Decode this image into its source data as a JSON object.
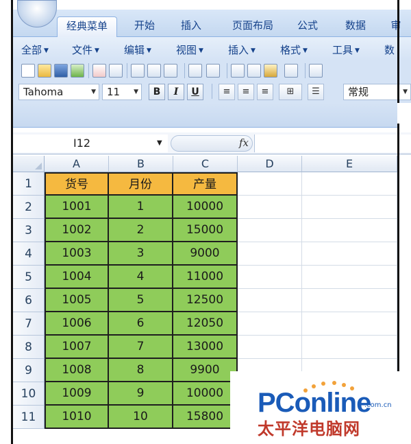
{
  "ribbon": {
    "tabs": [
      "经典菜单",
      "开始",
      "插入",
      "页面布局",
      "公式",
      "数据",
      "审"
    ],
    "active_tab": "经典菜单"
  },
  "menu": {
    "items": [
      "全部",
      "文件",
      "编辑",
      "视图",
      "插入",
      "格式",
      "工具",
      "数"
    ]
  },
  "format_toolbar": {
    "font_name": "Tahoma",
    "font_size": "11",
    "bold": "B",
    "italic": "I",
    "underline": "U",
    "number_format": "常规"
  },
  "formula_bar": {
    "name_box": "I12",
    "fx_label": "fx",
    "formula": ""
  },
  "sheet": {
    "columns": [
      "A",
      "B",
      "C",
      "D",
      "E"
    ],
    "row_numbers": [
      "1",
      "2",
      "3",
      "4",
      "5",
      "6",
      "7",
      "8",
      "9",
      "10",
      "11"
    ],
    "header": [
      "货号",
      "月份",
      "产量"
    ],
    "rows": [
      [
        "1001",
        "1",
        "10000"
      ],
      [
        "1002",
        "2",
        "15000"
      ],
      [
        "1003",
        "3",
        "9000"
      ],
      [
        "1004",
        "4",
        "11000"
      ],
      [
        "1005",
        "5",
        "12500"
      ],
      [
        "1006",
        "6",
        "12050"
      ],
      [
        "1007",
        "7",
        "13000"
      ],
      [
        "1008",
        "8",
        "9900"
      ],
      [
        "1009",
        "9",
        "10000"
      ],
      [
        "1010",
        "10",
        "15800"
      ]
    ],
    "colors": {
      "header_fill": "#f5b940",
      "data_fill": "#8fcc5a"
    }
  },
  "watermark": {
    "logo_text": "PConline",
    "domain": ".com.cn",
    "cn_text": "太平洋电脑网"
  }
}
